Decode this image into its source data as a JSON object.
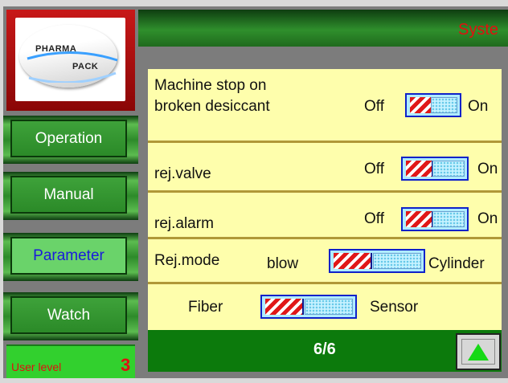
{
  "logo": {
    "line1": "PHARMA",
    "line2": "PACK"
  },
  "header": {
    "title": "Syste"
  },
  "nav": [
    {
      "label": "Operation",
      "active": false
    },
    {
      "label": "Manual",
      "active": false
    },
    {
      "label": "Parameter",
      "active": true
    },
    {
      "label": "Watch",
      "active": false
    }
  ],
  "user_level": {
    "label": "User level",
    "value": "3"
  },
  "params": {
    "r1": {
      "label_line1": "Machine stop on",
      "label_line2": "broken desiccant",
      "off": "Off",
      "on": "On",
      "state": "off"
    },
    "r2": {
      "label": "rej.valve",
      "off": "Off",
      "on": "On",
      "state": "off"
    },
    "r3": {
      "label": "rej.alarm",
      "off": "Off",
      "on": "On",
      "state": "off"
    },
    "r4": {
      "label": "Rej.mode",
      "left": "blow",
      "right": "Cylinder",
      "state": "left"
    },
    "r5": {
      "left": "Fiber",
      "right": "Sensor",
      "state": "left"
    }
  },
  "footer": {
    "page": "6/6"
  },
  "colors": {
    "accent_red": "#e01010",
    "panel_bg": "#fefeac",
    "nav_green": "#2b8a28",
    "active_blue": "#1a1adc"
  },
  "icons": {
    "page_up": "up-triangle-icon"
  }
}
